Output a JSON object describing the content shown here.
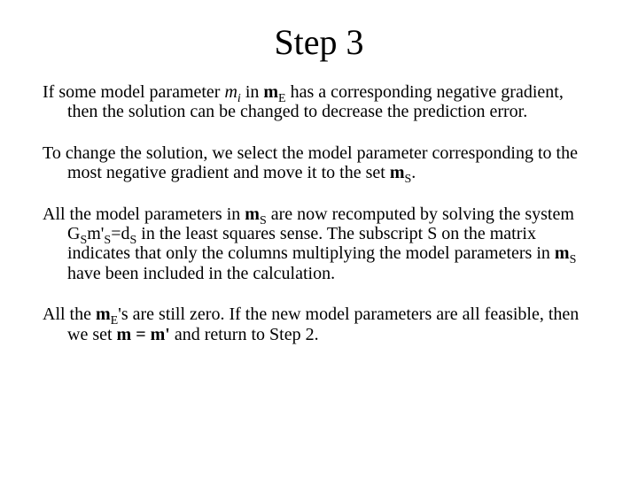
{
  "title": "Step 3",
  "p1": {
    "a": "If some model parameter ",
    "m": "m",
    "i": "i",
    "b": " in ",
    "mE_sym": "m",
    "mE_sub": "E",
    "c": " has a corresponding negative gradient, then the solution can be changed to decrease the prediction error."
  },
  "p2": {
    "a": "To change the solution, we select the model parameter corresponding to the most negative gradient and move it to the set ",
    "mS_sym": "m",
    "mS_sub": "S",
    "b": "."
  },
  "p3": {
    "a": "All the model parameters in ",
    "mS_sym": "m",
    "mS_sub": "S",
    "b": " are now recomputed by solving the system ",
    "eq": "G",
    "eq_S1": "S",
    "eq2": "m'",
    "eq_S2": "S",
    "eq3": "=d",
    "eq_S3": "S",
    "c": " in the least squares sense. The subscript S on the matrix indicates that only the columns multiplying the model parameters in ",
    "mS2_sym": "m",
    "mS2_sub": "S",
    "d": " have been included in the calculation."
  },
  "p4": {
    "a": "All the ",
    "mE_sym": "m",
    "mE_sub": "E",
    "b": "'s are still zero. If the new model parameters are all feasible, then we set ",
    "m_eq": "m = m'",
    "c": " and return to Step 2."
  }
}
